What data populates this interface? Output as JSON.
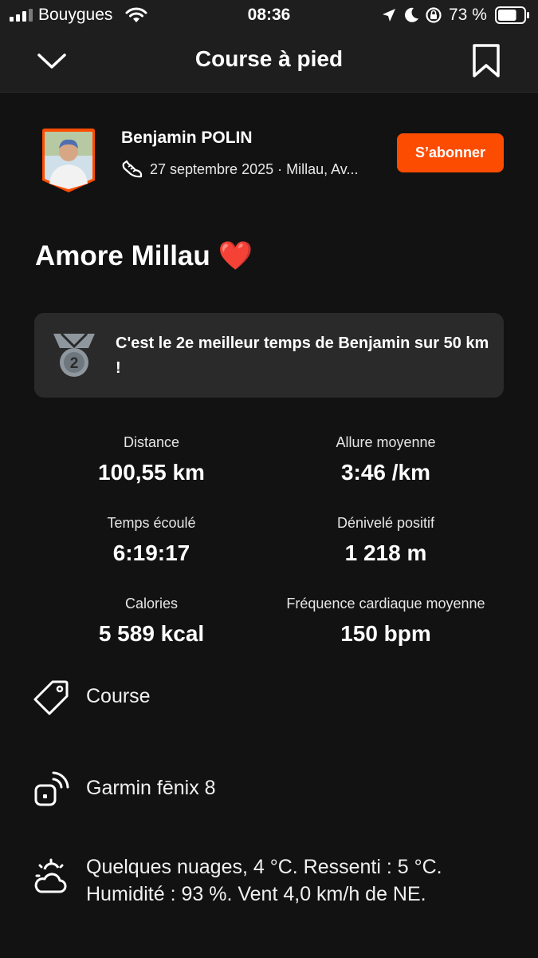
{
  "status_bar": {
    "carrier": "Bouygues",
    "time": "08:36",
    "battery": "73 %",
    "battery_level": 0.73,
    "icons": [
      "signal-icon",
      "wifi-icon",
      "location-icon",
      "moon-icon",
      "rotation-lock-icon",
      "battery-icon"
    ]
  },
  "nav": {
    "title": "Course à pied",
    "back_icon": "chevron-down-icon",
    "bookmark_icon": "bookmark-icon"
  },
  "athlete": {
    "name": "Benjamin POLIN",
    "meta": "27 septembre 2025 · Millau, Av...",
    "activity_icon": "shoe-icon",
    "subscribe_label": "S’abonner"
  },
  "activity": {
    "title": "Amore Millau ❤️"
  },
  "achievement": {
    "icon": "medal-2-icon",
    "medal_number": "2",
    "text": "C'est le 2e meilleur temps de Benjamin sur 50 km !"
  },
  "stats": [
    {
      "label": "Distance",
      "value": "100,55 km"
    },
    {
      "label": "Allure moyenne",
      "value": "3:46 /km"
    },
    {
      "label": "Temps écoulé",
      "value": "6:19:17"
    },
    {
      "label": "Dénivelé positif",
      "value": "1 218 m"
    },
    {
      "label": "Calories",
      "value": "5 589 kcal"
    },
    {
      "label": "Fréquence cardiaque moyenne",
      "value": "150 bpm"
    }
  ],
  "details": {
    "type": "Course",
    "device": "Garmin fēnix 8",
    "weather": "Quelques nuages, 4  °C. Ressenti : 5  °C. Humidité : 93 %. Vent 4,0 km/h de NE."
  },
  "colors": {
    "background": "#121212",
    "header": "#1e1e1e",
    "accent": "#fc4c02",
    "card": "#2a2a2a"
  }
}
